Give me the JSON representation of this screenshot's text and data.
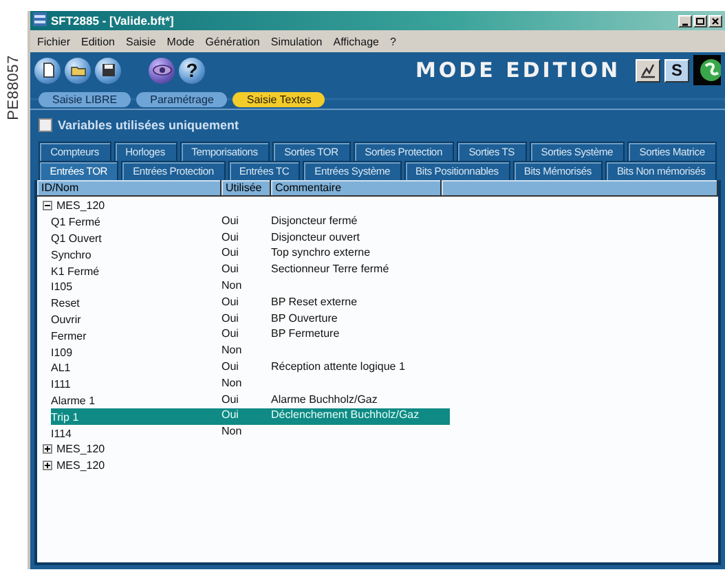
{
  "side_label": "PE88057",
  "window": {
    "title": "SFT2885 - [Valide.bft*]"
  },
  "menu": [
    "Fichier",
    "Edition",
    "Saisie",
    "Mode",
    "Génération",
    "Simulation",
    "Affichage",
    "?"
  ],
  "toolbar": {
    "help": "?",
    "mode_label": "MODE EDITION",
    "s_button": "S"
  },
  "mode_tabs": [
    {
      "label": "Saisie LIBRE",
      "selected": false
    },
    {
      "label": "Paramétrage",
      "selected": false
    },
    {
      "label": "Saisie Textes",
      "selected": true
    }
  ],
  "filter": {
    "label": "Variables utilisées uniquement",
    "checked": false
  },
  "tab_rows": [
    {
      "tabs": [
        {
          "label": "Compteurs",
          "selected": false
        },
        {
          "label": "Horloges",
          "selected": false
        },
        {
          "label": "Temporisations",
          "selected": false
        },
        {
          "label": "Sorties TOR",
          "selected": false
        },
        {
          "label": "Sorties Protection",
          "selected": false
        },
        {
          "label": "Sorties TS",
          "selected": false
        },
        {
          "label": "Sorties Système",
          "selected": false
        },
        {
          "label": "Sorties Matrice",
          "selected": false
        }
      ]
    },
    {
      "tabs": [
        {
          "label": "Entrées TOR",
          "selected": true
        },
        {
          "label": "Entrées Protection",
          "selected": false
        },
        {
          "label": "Entrées TC",
          "selected": false
        },
        {
          "label": "Entrées Système",
          "selected": false
        },
        {
          "label": "Bits Positionnables",
          "selected": false
        },
        {
          "label": "Bits Mémorisés",
          "selected": false
        },
        {
          "label": "Bits Non mémorisés",
          "selected": false
        }
      ]
    }
  ],
  "table": {
    "columns": [
      "ID/Nom",
      "Utilisée",
      "Commentaire"
    ],
    "tree": [
      {
        "name": "MES_120",
        "expanded": true,
        "children": [
          {
            "name": "Q1 Fermé",
            "used": "Oui",
            "comment": "Disjoncteur fermé",
            "selected": false
          },
          {
            "name": "Q1 Ouvert",
            "used": "Oui",
            "comment": "Disjoncteur ouvert",
            "selected": false
          },
          {
            "name": "Synchro",
            "used": "Oui",
            "comment": "Top synchro externe",
            "selected": false
          },
          {
            "name": "K1 Fermé",
            "used": "Oui",
            "comment": "Sectionneur Terre fermé",
            "selected": false
          },
          {
            "name": "I105",
            "used": "Non",
            "selected": false
          },
          {
            "name": "Reset",
            "used": "Oui",
            "comment": "BP Reset externe",
            "selected": false
          },
          {
            "name": "Ouvrir",
            "used": "Oui",
            "comment": "BP Ouverture",
            "selected": false
          },
          {
            "name": "Fermer",
            "used": "Oui",
            "comment": "BP Fermeture",
            "selected": false
          },
          {
            "name": "I109",
            "used": "Non",
            "selected": false
          },
          {
            "name": "AL1",
            "used": "Oui",
            "comment": "Réception attente logique 1",
            "selected": false
          },
          {
            "name": "I111",
            "used": "Non",
            "selected": false
          },
          {
            "name": "Alarme 1",
            "used": "Oui",
            "comment": "Alarme Buchholz/Gaz",
            "selected": false
          },
          {
            "name": "Trip 1",
            "used": "Oui",
            "comment": "Déclenchement Buchholz/Gaz",
            "selected": true
          },
          {
            "name": "I114",
            "used": "Non",
            "selected": false
          }
        ]
      },
      {
        "name": "MES_120",
        "expanded": false
      },
      {
        "name": "MES_120",
        "expanded": false
      }
    ]
  }
}
